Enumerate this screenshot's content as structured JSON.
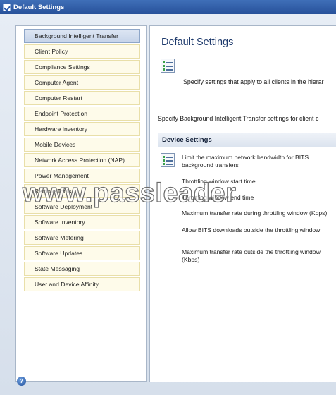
{
  "window": {
    "title": "Default Settings"
  },
  "sidebar": {
    "items": [
      {
        "label": "Background Intelligent Transfer",
        "selected": true
      },
      {
        "label": "Client Policy"
      },
      {
        "label": "Compliance Settings"
      },
      {
        "label": "Computer Agent"
      },
      {
        "label": "Computer Restart"
      },
      {
        "label": "Endpoint Protection"
      },
      {
        "label": "Hardware Inventory"
      },
      {
        "label": "Mobile Devices"
      },
      {
        "label": "Network Access Protection (NAP)"
      },
      {
        "label": "Power Management"
      },
      {
        "label": "Remote Tools"
      },
      {
        "label": "Software Deployment"
      },
      {
        "label": "Software Inventory"
      },
      {
        "label": "Software Metering"
      },
      {
        "label": "Software Updates"
      },
      {
        "label": "State Messaging"
      },
      {
        "label": "User and Device Affinity"
      }
    ]
  },
  "main": {
    "title": "Default Settings",
    "intro": "Specify settings that apply to all clients in the hierar",
    "specify": "Specify Background Intelligent Transfer settings for client c",
    "group_header": "Device Settings",
    "settings": [
      "Limit the maximum network bandwidth for BITS background transfers",
      "Throttling window start time",
      "Throttling window end time",
      "Maximum transfer rate during throttling window (Kbps)",
      "Allow BITS downloads outside the throttling window",
      "Maximum transfer rate outside the throttling window (Kbps)"
    ]
  },
  "footer": {
    "help_icon": "help-icon"
  },
  "watermark": {
    "text": "www.passleader"
  },
  "colors": {
    "title_bar": "#2f5ea8",
    "nav_item_bg": "#fefbea",
    "nav_selected_bg": "#cfdbee",
    "page_title": "#1e3a6c"
  }
}
